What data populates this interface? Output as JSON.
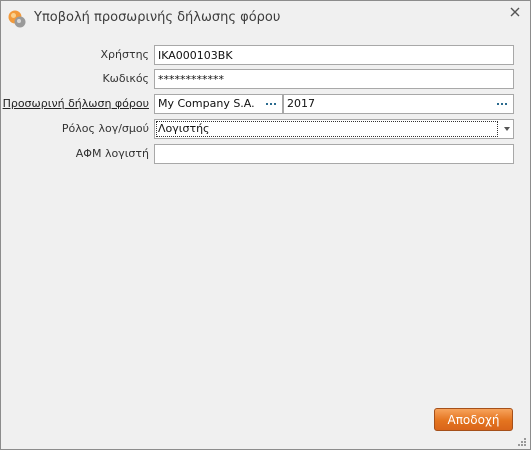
{
  "window": {
    "title": "Υποβολή προσωρινής δήλωσης φόρου"
  },
  "form": {
    "user": {
      "label": "Χρήστης",
      "value": "IKA000103BK"
    },
    "password": {
      "label": "Κωδικός",
      "value": "************"
    },
    "declaration": {
      "label": "Προσωρινή δήλωση φόρου",
      "company": "My Company S.A.",
      "year": "2017"
    },
    "accountant_role": {
      "label": "Ρόλος λογ/σμού",
      "value": "Λογιστής"
    },
    "accountant_afm": {
      "label": "ΑΦΜ λογιστή",
      "value": ""
    }
  },
  "buttons": {
    "accept_label": "Αποδοχή"
  },
  "icons": {
    "app": "app-logo-icon",
    "close": "close-icon",
    "lookup": "ellipsis-icon",
    "dropdown": "chevron-down-icon",
    "resize": "resize-grip-icon"
  },
  "colors": {
    "accent": "#e4741f",
    "window_bg": "#f0f0f0",
    "lookup_dots": "#2a6a8e"
  }
}
